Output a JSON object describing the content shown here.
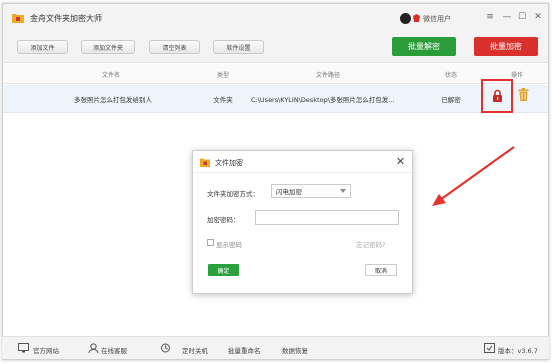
{
  "app": {
    "title": "金舟文件夹加密大师"
  },
  "user": {
    "name": "微信用户"
  },
  "window_controls": {
    "menu": "≡",
    "minimize": "—",
    "maximize": "☐",
    "close": "✕"
  },
  "toolbar": {
    "add_file": "添加文件",
    "add_folder": "添加文件夹",
    "clear_list": "清空列表",
    "settings": "软件设置",
    "batch_decrypt": "批量解密",
    "batch_encrypt": "批量加密"
  },
  "table": {
    "headers": [
      "文件名",
      "类型",
      "文件路径",
      "状态",
      "操作"
    ],
    "rows": [
      {
        "name": "多张照片怎么打包发给别人",
        "type": "文件夹",
        "path": "C:\\Users\\KYLIN\\Desktop\\多张照片怎么打包发...",
        "status": "已解密"
      }
    ]
  },
  "dialog": {
    "title": "文件加密",
    "method_label": "文件夹加密方式：",
    "method_value": "闪电加密",
    "password_label": "加密密码：",
    "password_value": "",
    "show_password": "显示密码",
    "forgot_password": "忘记密码?",
    "ok": "确定",
    "cancel": "取消"
  },
  "statusbar": {
    "website": "官方网站",
    "support": "在线客服",
    "shutdown": "定时关机",
    "rename": "批量重命名",
    "recovery": "数据恢复",
    "version": "版本：v3.6.7"
  },
  "colors": {
    "decrypt_green": "#2a9d3a",
    "encrypt_red": "#d9302b",
    "annotation_red": "#e5322d"
  }
}
